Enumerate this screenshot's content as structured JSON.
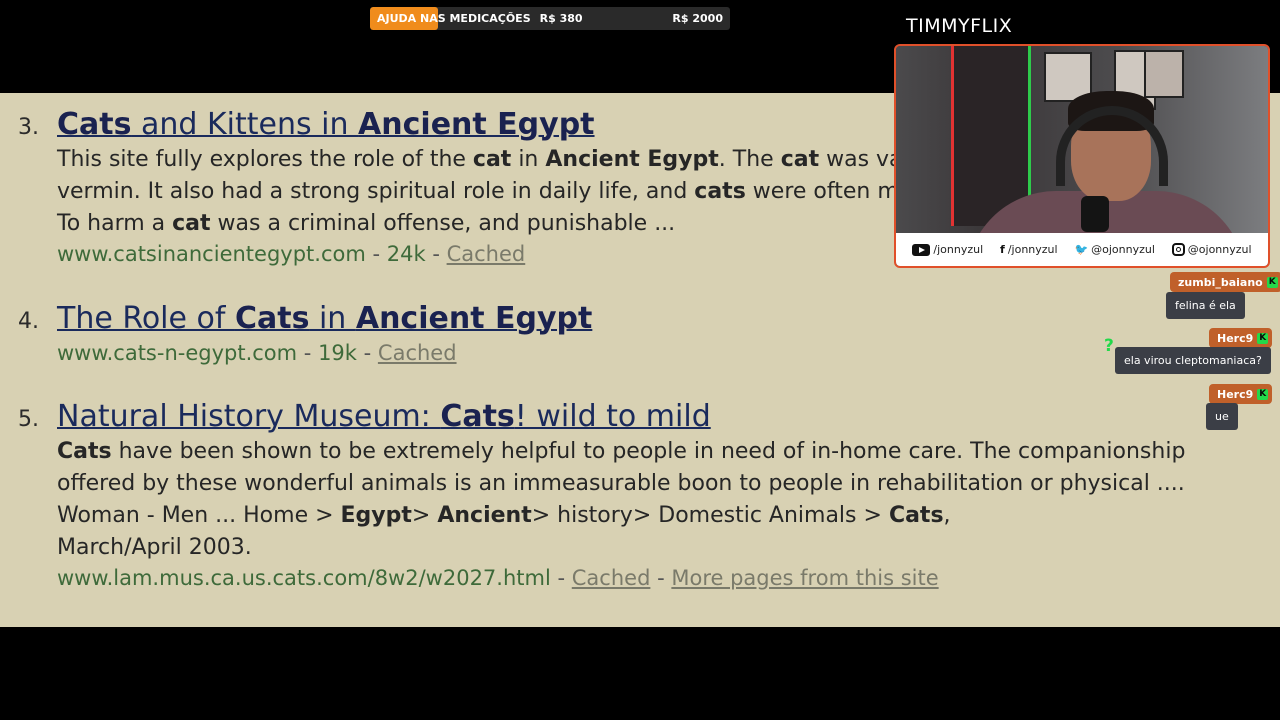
{
  "goal": {
    "label": "AJUDA NAS MEDICAÇÕES",
    "current": "R$ 380",
    "target": "R$ 2000",
    "progress_fraction": 0.19,
    "color": "#f08c1c"
  },
  "channel": {
    "name": "TIMMYFLIX"
  },
  "results": [
    {
      "number": "3.",
      "title": [
        {
          "t": "Cats",
          "b": true
        },
        {
          "t": " and Kittens in ",
          "b": false
        },
        {
          "t": "Ancient Egypt",
          "b": true
        }
      ],
      "snippet": [
        [
          {
            "t": "This site fully explores the role of the ",
            "b": false
          },
          {
            "t": "cat",
            "b": true
          },
          {
            "t": " in ",
            "b": false
          },
          {
            "t": "Ancient Egypt",
            "b": true
          },
          {
            "t": ".  The ",
            "b": false
          },
          {
            "t": "cat",
            "b": true
          },
          {
            "t": " was va",
            "b": false
          }
        ],
        [
          {
            "t": "vermin.  It also had a strong spiritual role in daily life, and ",
            "b": false
          },
          {
            "t": "cats",
            "b": true
          },
          {
            "t": " were often m",
            "b": false
          }
        ],
        [
          {
            "t": "To harm a ",
            "b": false
          },
          {
            "t": "cat",
            "b": true
          },
          {
            "t": " was a criminal offense, and punishable ...",
            "b": false
          }
        ]
      ],
      "url": "www.catsinancientegypt.com",
      "size": "24k",
      "links": [
        "Cached"
      ]
    },
    {
      "number": "4.",
      "title": [
        {
          "t": "The Role of ",
          "b": false
        },
        {
          "t": "Cats",
          "b": true
        },
        {
          "t": " in ",
          "b": false
        },
        {
          "t": "Ancient Egypt",
          "b": true
        }
      ],
      "snippet": [],
      "url": "www.cats-n-egypt.com",
      "size": "19k",
      "links": [
        "Cached"
      ]
    },
    {
      "number": "5.",
      "title": [
        {
          "t": "Natural History Museum: ",
          "b": false
        },
        {
          "t": "Cats",
          "b": true
        },
        {
          "t": "! wild to mild",
          "b": false
        }
      ],
      "snippet": [
        [
          {
            "t": "Cats",
            "b": true
          },
          {
            "t": " have been shown to be extremely helpful to people in need of in-home care.  The companionship",
            "b": false
          }
        ],
        [
          {
            "t": "offered by these wonderful animals is an immeasurable boon to people in rehabilitation or physical ....",
            "b": false
          }
        ],
        [
          {
            "t": "Woman - Men ... Home > ",
            "b": false
          },
          {
            "t": "Egypt",
            "b": true
          },
          {
            "t": "> ",
            "b": false
          },
          {
            "t": "Ancient",
            "b": true
          },
          {
            "t": "> history> Domestic Animals > ",
            "b": false
          },
          {
            "t": "Cats",
            "b": true
          },
          {
            "t": ",",
            "b": false
          }
        ],
        [
          {
            "t": "March/April 2003.",
            "b": false
          }
        ]
      ],
      "url": "www.lam.mus.ca.us.cats.com/8w2/w2027.html",
      "size": "",
      "links": [
        "Cached",
        "More pages from this site"
      ]
    }
  ],
  "socials": [
    {
      "icon": "youtube-icon",
      "handle": "/jonnyzul"
    },
    {
      "icon": "facebook-icon",
      "handle": "/jonnyzul"
    },
    {
      "icon": "twitter-icon",
      "handle": "@ojonnyzul"
    },
    {
      "icon": "instagram-icon",
      "handle": "@ojonnyzul"
    }
  ],
  "chat": [
    {
      "user": "zumbi_baiano",
      "message": "felina é ela"
    },
    {
      "user": "Herc9",
      "message": "ela virou cleptomaniaca?"
    },
    {
      "user": "Herc9",
      "message": "ue"
    }
  ]
}
